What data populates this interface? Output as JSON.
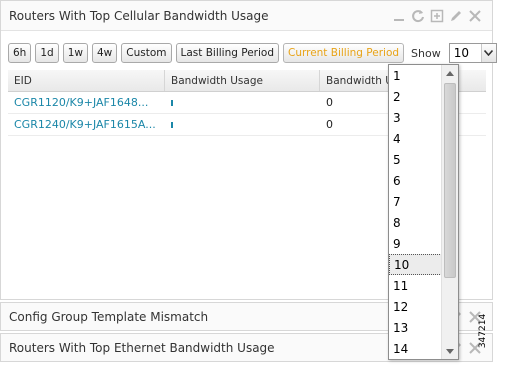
{
  "dashlets": [
    {
      "title": "Routers With Top Cellular Bandwidth Usage"
    },
    {
      "title": "Config Group Template Mismatch"
    },
    {
      "title": "Routers With Top Ethernet Bandwidth Usage"
    }
  ],
  "toolbar": {
    "buttons": [
      "6h",
      "1d",
      "1w",
      "4w",
      "Custom",
      "Last Billing Period",
      "Current Billing Period"
    ],
    "active_button": "Current Billing Period",
    "show_label": "Show",
    "show_value": "10"
  },
  "table": {
    "columns": [
      "EID",
      "Bandwidth Usage",
      "Bandwidth Us"
    ],
    "rows": [
      {
        "eid": "CGR1120/K9+JAF1648...",
        "usage_bar": 0.01,
        "usage": "0"
      },
      {
        "eid": "CGR1240/K9+JAF1615A...",
        "usage_bar": 0.01,
        "usage": "0"
      }
    ]
  },
  "dropdown": {
    "options": [
      "1",
      "2",
      "3",
      "4",
      "5",
      "6",
      "7",
      "8",
      "9",
      "10",
      "11",
      "12",
      "13",
      "14"
    ],
    "selected": "10"
  },
  "figure_id": "347214",
  "colors": {
    "link": "#1b87a8",
    "active_button": "#e8a317",
    "header_icons": "#b8b8b8"
  }
}
